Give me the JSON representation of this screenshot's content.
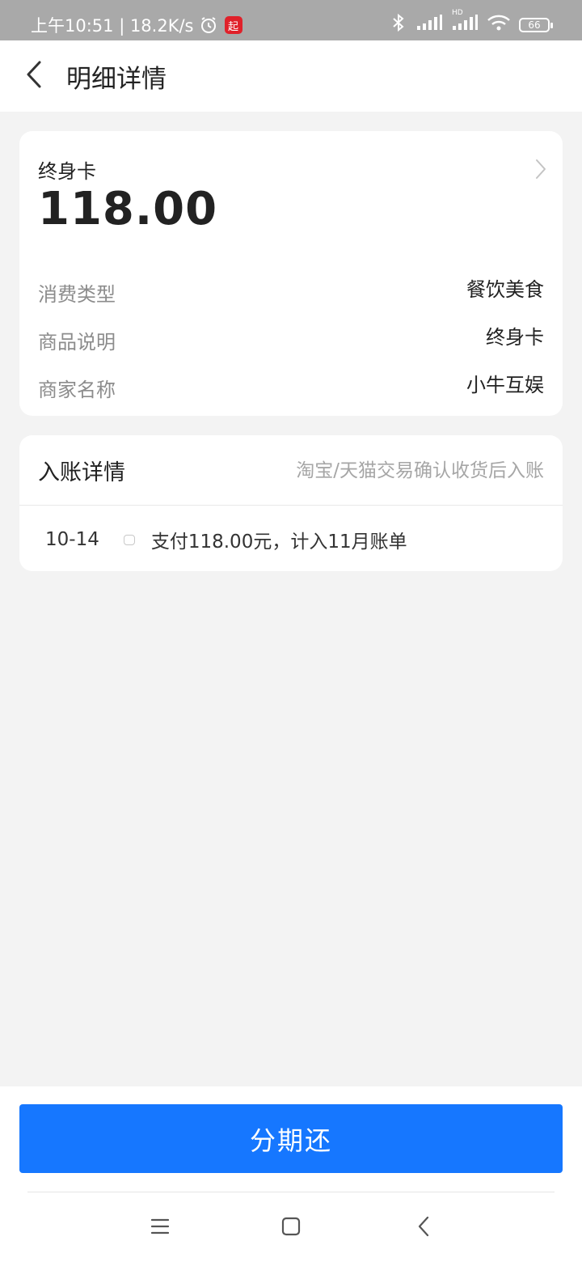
{
  "status_bar": {
    "time_text": "上午10:51 | 18.2K/s",
    "app_badge": "起",
    "battery": "66",
    "hd_label": "HD"
  },
  "header": {
    "title": "明细详情"
  },
  "summary": {
    "subtitle": "终身卡",
    "amount": "118.00",
    "rows": [
      {
        "label": "消费类型",
        "value": "餐饮美食"
      },
      {
        "label": "商品说明",
        "value": "终身卡"
      },
      {
        "label": "商家名称",
        "value": "小牛互娱"
      }
    ]
  },
  "ledger": {
    "title": "入账详情",
    "note": "淘宝/天猫交易确认收货后入账",
    "entries": [
      {
        "date": "10-14",
        "text": "支付118.00元，计入11月账单"
      }
    ]
  },
  "action": {
    "label": "分期还",
    "color": "#1677ff"
  },
  "icons": {
    "back": "back-arrow-icon",
    "detail": "chevron-right-icon",
    "nav_menu": "menu-icon",
    "nav_home": "home-square-icon",
    "nav_back": "back-icon"
  }
}
